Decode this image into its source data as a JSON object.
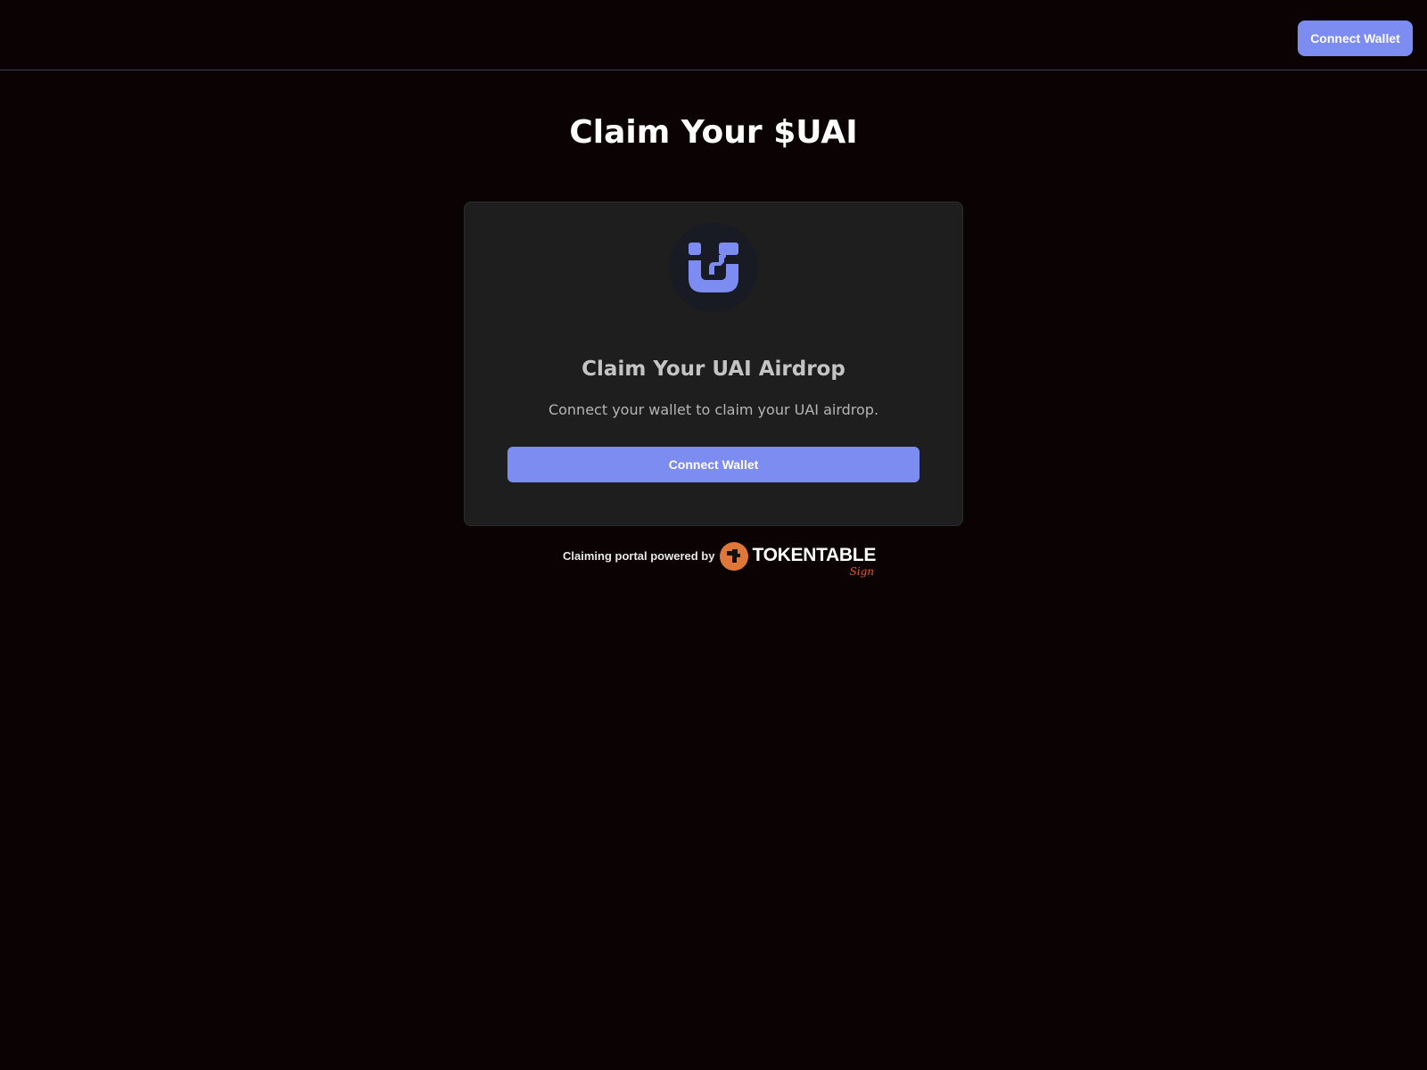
{
  "header": {
    "connect_wallet_label": "Connect Wallet"
  },
  "main": {
    "title": "Claim Your $UAI"
  },
  "card": {
    "logo_icon": "uai-logo-icon",
    "title": "Claim Your UAI Airdrop",
    "description": "Connect your wallet to claim your UAI airdrop.",
    "connect_wallet_label": "Connect Wallet"
  },
  "footer": {
    "powered_by_text": "Claiming portal powered by",
    "brand_name": "TOKENTABLE",
    "brand_sub": "Sign"
  },
  "colors": {
    "background": "#0a0203",
    "accent": "#7d8cf0",
    "card_background": "#1e1e1e",
    "brand_orange": "#e0773a"
  }
}
